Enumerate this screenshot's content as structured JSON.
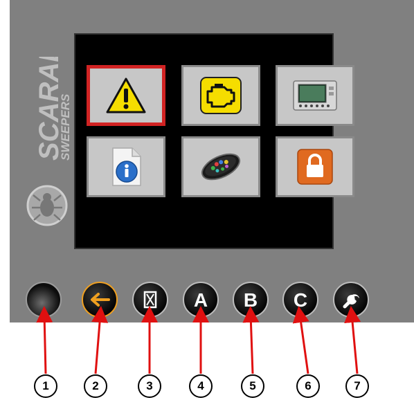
{
  "brand": {
    "name": "SCARAB",
    "subtitle": "SWEEPERS"
  },
  "menu_tiles": [
    {
      "icon": "warning-icon",
      "selected": true
    },
    {
      "icon": "engine-check-icon",
      "selected": false
    },
    {
      "icon": "display-unit-icon",
      "selected": false
    },
    {
      "icon": "info-document-icon",
      "selected": false
    },
    {
      "icon": "control-pad-icon",
      "selected": false
    },
    {
      "icon": "lock-icon",
      "selected": false
    }
  ],
  "buttons": [
    {
      "icon": "blank-button-icon"
    },
    {
      "icon": "back-arrow-icon"
    },
    {
      "icon": "hourglass-icon",
      "label": ""
    },
    {
      "icon": "letter-a-icon",
      "label": "A"
    },
    {
      "icon": "letter-b-icon",
      "label": "B"
    },
    {
      "icon": "letter-c-icon",
      "label": "C"
    },
    {
      "icon": "wrench-icon"
    }
  ],
  "callouts": [
    "1",
    "2",
    "3",
    "4",
    "5",
    "6",
    "7"
  ],
  "colors": {
    "panel": "#808080",
    "selected_border": "#d12323",
    "back_accent": "#f0a020",
    "warning": "#f5dd00",
    "lock": "#e06a20"
  }
}
